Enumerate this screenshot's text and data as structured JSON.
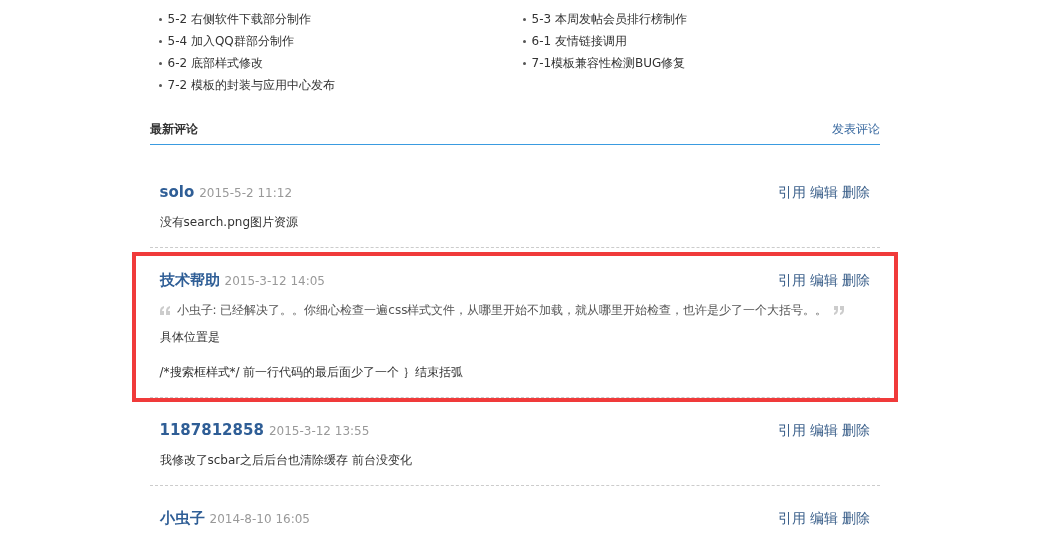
{
  "lessons": [
    {
      "label": "5-2 右侧软件下载部分制作"
    },
    {
      "label": "5-3 本周发帖会员排行榜制作"
    },
    {
      "label": "5-4 加入QQ群部分制作"
    },
    {
      "label": "6-1 友情链接调用"
    },
    {
      "label": "6-2 底部样式修改"
    },
    {
      "label": "7-1模板兼容性检测BUG修复"
    },
    {
      "label": "7-2 模板的封装与应用中心发布"
    }
  ],
  "comments_section": {
    "title": "最新评论",
    "post_link": "发表评论",
    "comments": [
      {
        "author": "solo",
        "time": "2015-5-2 11:12",
        "actions": [
          "引用",
          "编辑",
          "删除"
        ],
        "highlighted": false,
        "body": [
          {
            "kind": "text",
            "text": "没有search.png图片资源"
          }
        ]
      },
      {
        "author": "技术帮助",
        "time": "2015-3-12 14:05",
        "actions": [
          "引用",
          "编辑",
          "删除"
        ],
        "highlighted": true,
        "body": [
          {
            "kind": "quote",
            "text": "小虫子: 已经解决了。。你细心检查一遍css样式文件，从哪里开始不加载，就从哪里开始检查，也许是少了一个大括号。。"
          },
          {
            "kind": "text",
            "text": "具体位置是"
          },
          {
            "kind": "text",
            "text": "/*搜索框样式*/  前一行代码的最后面少了一个 ｝结束括弧"
          }
        ]
      },
      {
        "author": "1187812858",
        "time": "2015-3-12 13:55",
        "actions": [
          "引用",
          "编辑",
          "删除"
        ],
        "highlighted": false,
        "body": [
          {
            "kind": "text",
            "text": "我修改了scbar之后后台也清除缓存 前台没变化"
          }
        ]
      },
      {
        "author": "小虫子",
        "time": "2014-8-10 16:05",
        "actions": [
          "引用",
          "编辑",
          "删除"
        ],
        "highlighted": false
      }
    ]
  }
}
